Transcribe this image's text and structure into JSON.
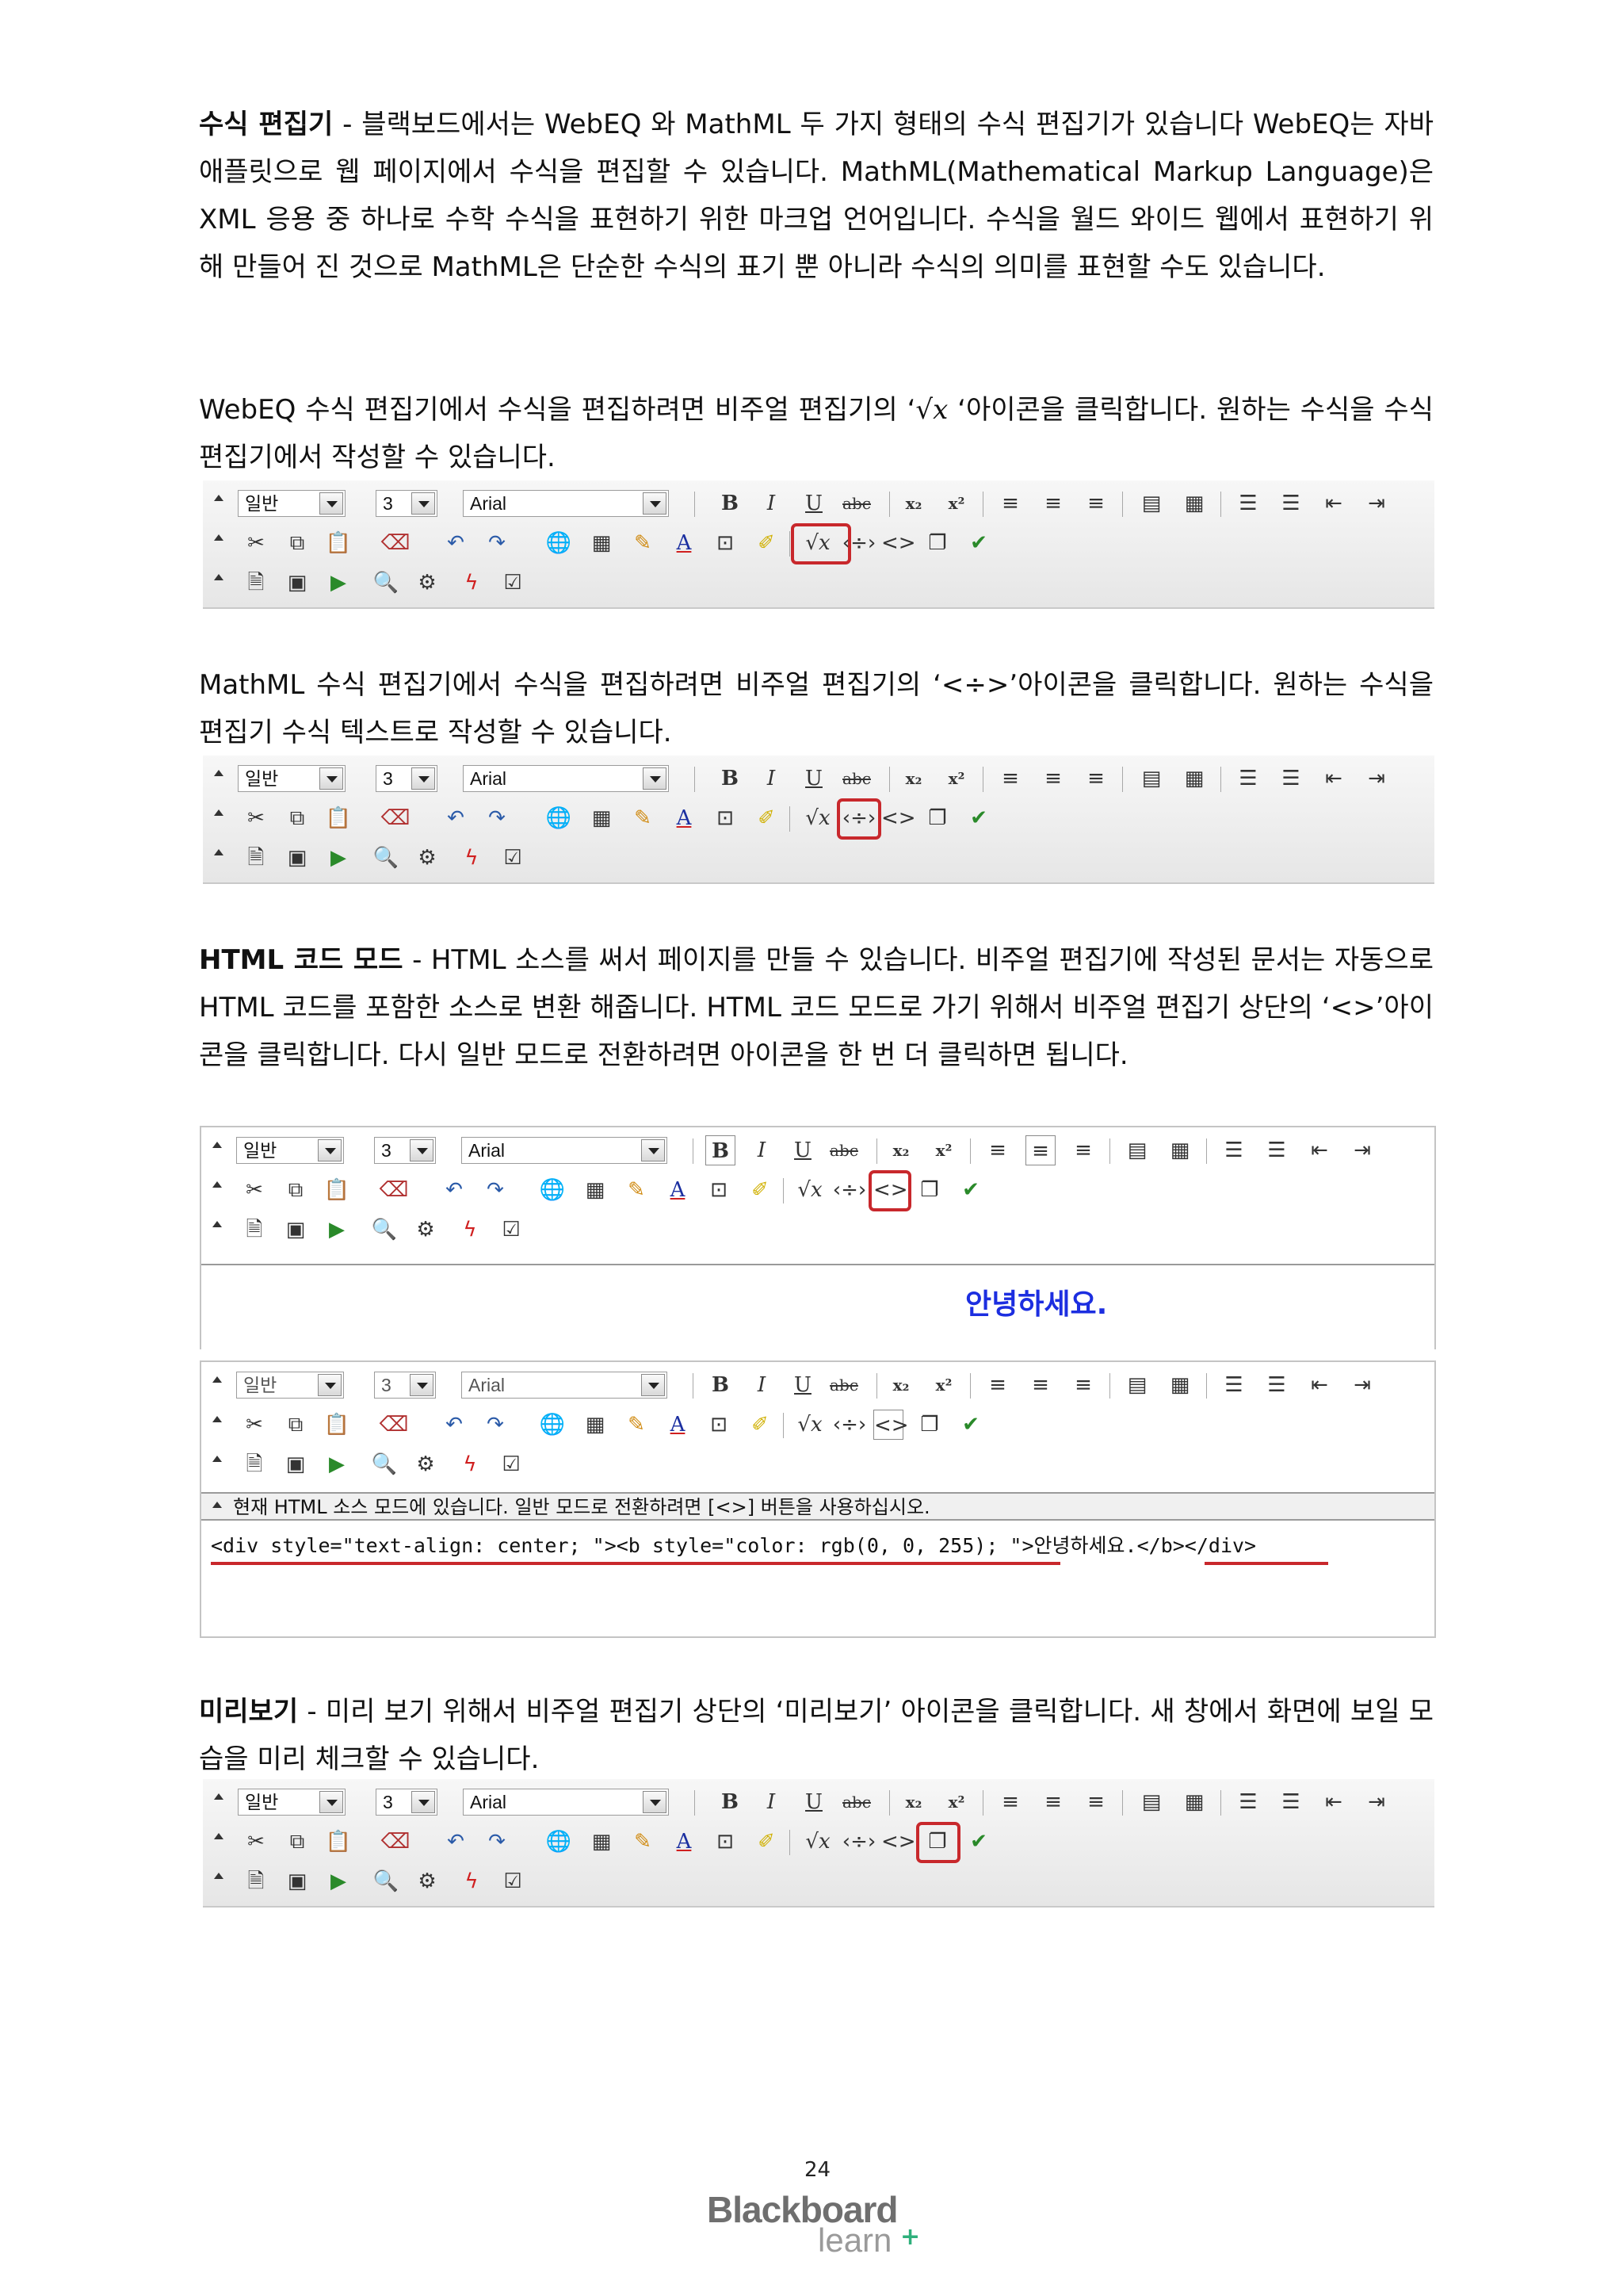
{
  "sections": {
    "formula": {
      "title": "수식 편집기",
      "body": " - 블랙보드에서는 WebEQ 와 MathML 두 가지 형태의 수식 편집기가 있습니다 WebEQ는 자바 애플릿으로 웹 페이지에서 수식을 편집할 수 있습니다. MathML(Mathematical Markup Language)은 XML 응용 중 하나로 수학 수식을 표현하기 위한 마크업 언어입니다. 수식을 월드 와이드 웹에서 표현하기 위해 만들어 진 것으로 MathML은 단순한 수식의 표기 뿐 아니라 수식의 의미를 표현할 수도 있습니다."
    },
    "webeq": {
      "before": "WebEQ 수식 편집기에서 수식을 편집하려면 비주얼 편집기의 ‘",
      "symbol": "√x",
      "after": " ‘아이콘을 클릭합니다. 원하는 수식을 수식 편집기에서 작성할 수 있습니다."
    },
    "mathml": {
      "text": "MathML 수식 편집기에서 수식을 편집하려면 비주얼 편집기의 ‘<÷>’아이콘을 클릭합니다. 원하는 수식을 편집기 수식 텍스트로 작성할 수 있습니다."
    },
    "html_mode": {
      "title": "HTML 코드 모드",
      "body": " - HTML 소스를 써서 페이지를 만들 수 있습니다. 비주얼 편집기에 작성된 문서는 자동으로 HTML 코드를 포함한 소스로 변환 해줍니다. HTML 코드 모드로 가기 위해서 비주얼 편집기 상단의 ‘<>’아이콘을 클릭합니다. 다시 일반 모드로 전환하려면 아이콘을 한 번 더 클릭하면 됩니다."
    },
    "preview": {
      "title": "미리보기",
      "body": " - 미리 보기 위해서 비주얼 편집기 상단의 ‘미리보기’ 아이콘을 클릭합니다. 새 창에서 화면에 보일 모습을 미리 체크할 수 있습니다."
    }
  },
  "toolbar": {
    "format_value": "일반",
    "size_value": "3",
    "font_value": "Arial",
    "bold": "B",
    "italic": "I",
    "underline": "U",
    "strike": "abc",
    "subscript": "x₂",
    "superscript": "x²",
    "icons_row1": [
      "align-left-icon",
      "align-center-icon",
      "align-right-icon",
      "spellcheck-icon",
      "paste-icon",
      "ordered-list-icon",
      "unordered-list-icon",
      "outdent-icon",
      "indent-icon"
    ],
    "icons_row2": [
      "cut-icon",
      "copy-icon",
      "paste-icon",
      "clear-format-icon",
      "undo-icon",
      "redo-icon",
      "link-icon",
      "table-icon",
      "pencil-icon",
      "font-color-icon",
      "image-icon",
      "highlight-icon",
      "math-webeq-icon",
      "mathml-icon",
      "html-mode-icon",
      "preview-icon",
      "spell-check-icon"
    ],
    "icons_row3": [
      "insert-file-icon",
      "insert-image-icon",
      "insert-media-icon",
      "search-file-icon",
      "mashup-icon",
      "flash-icon",
      "template-icon"
    ]
  },
  "html_example": {
    "greeting": "안녕하세요.",
    "status": "현재 HTML 소스 모드에 있습니다. 일반 모드로 전환하려면 [<>] 버튼을 사용하십시오.",
    "source": "<div style=\"text-align: center; \"><b style=\"color: rgb(0, 0, 255); \">안녕하세요.</b></div>"
  },
  "footer": {
    "page_number": "24",
    "brand": "Blackboard",
    "brand_sub": "learn"
  },
  "colors": {
    "highlight": "#c8282c",
    "greeting": "#1c2ee0",
    "brand_plus": "#2fb07c"
  }
}
